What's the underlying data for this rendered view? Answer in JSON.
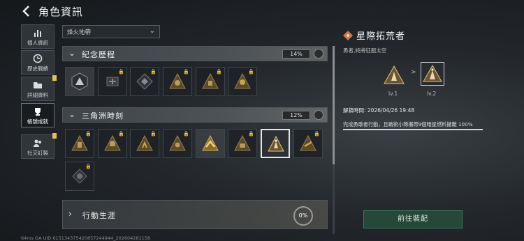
{
  "header": {
    "title": "角色資訊",
    "back_icon": "back-chevron-icon"
  },
  "sidebar": {
    "items": [
      {
        "label": "個人資訊",
        "icon": "bar-chart-icon",
        "active": false,
        "badge": false
      },
      {
        "label": "歷史戰績",
        "icon": "clock-icon",
        "active": false,
        "badge": false
      },
      {
        "label": "詳細資料",
        "icon": "folder-icon",
        "active": false,
        "badge": true
      },
      {
        "label": "帳號成就",
        "icon": "trophy-icon",
        "active": true,
        "badge": false
      },
      {
        "label": "社交訂製",
        "icon": "social-icon",
        "active": false,
        "badge": true
      }
    ]
  },
  "filter": {
    "selected": "烽火地帶"
  },
  "categories": [
    {
      "name": "紀念歷程",
      "percent": "14%",
      "expanded": true
    },
    {
      "name": "三角洲時刻",
      "percent": "12%",
      "expanded": true
    },
    {
      "name": "行動生涯",
      "percent": "0%",
      "expanded": false
    }
  ],
  "detail": {
    "title": "星際拓荒者",
    "description": "勇者,終將征服太空",
    "level_from": "lv.1",
    "level_to": "lv.2",
    "unlock_time": "解鎖時間: 2026/04/26 19:48",
    "condition": "完成勇敢者行動，且戰術小隊攜帶9個暗星燃料撤離 100%",
    "progress": 1.0,
    "equip_label": "前往裝配"
  },
  "footer": {
    "text": "64ms    GA UID 615134375420857244944_202604281158"
  },
  "colors": {
    "accent_green": "#25483a",
    "gold": "#c9a64a",
    "badge": "#e3c14a"
  }
}
